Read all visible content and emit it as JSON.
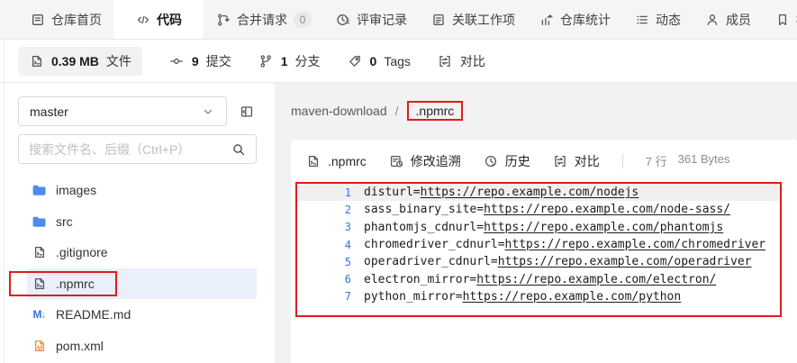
{
  "nav": {
    "items": [
      {
        "name": "repo-home",
        "icon": "repo-icon",
        "label": "仓库首页",
        "active": false
      },
      {
        "name": "code",
        "icon": "code-icon",
        "label": "代码",
        "active": true
      },
      {
        "name": "merge-requests",
        "icon": "merge-icon",
        "label": "合并请求",
        "badge": "0",
        "active": false
      },
      {
        "name": "review-records",
        "icon": "review-clock-icon",
        "label": "评审记录",
        "active": false
      },
      {
        "name": "work-items",
        "icon": "workitem-icon",
        "label": "关联工作项",
        "active": false
      },
      {
        "name": "repo-stats",
        "icon": "chart-icon",
        "label": "仓库统计",
        "active": false
      },
      {
        "name": "activity",
        "icon": "activity-list-icon",
        "label": "动态",
        "active": false
      },
      {
        "name": "members",
        "icon": "member-icon",
        "label": "成员",
        "active": false
      },
      {
        "name": "tags-nav",
        "icon": "bookmark-icon",
        "label": "标",
        "active": false
      }
    ]
  },
  "toolbar": {
    "items": [
      {
        "name": "file-size",
        "icon": "file-code-icon",
        "strong": "0.39 MB",
        "label": "文件",
        "active": true
      },
      {
        "name": "commits",
        "icon": "commit-icon",
        "strong": "9",
        "label": "提交",
        "active": false
      },
      {
        "name": "branches",
        "icon": "branch-icon",
        "strong": "1",
        "label": "分支",
        "active": false
      },
      {
        "name": "tags",
        "icon": "tag-icon",
        "strong": "0",
        "label": "Tags",
        "active": false
      },
      {
        "name": "compare",
        "icon": "compare-icon",
        "strong": "",
        "label": "对比",
        "active": false
      }
    ]
  },
  "sidebar": {
    "branch": "master",
    "search_placeholder": "搜索文件名、后缀（Ctrl+P）",
    "files": [
      {
        "label": "images",
        "icon": "folder-icon",
        "selected": false,
        "annotated": false
      },
      {
        "label": "src",
        "icon": "folder-icon",
        "selected": false,
        "annotated": false
      },
      {
        "label": ".gitignore",
        "icon": "file-code-icon",
        "selected": false,
        "annotated": false
      },
      {
        "label": ".npmrc",
        "icon": "file-code-icon",
        "selected": true,
        "annotated": true
      },
      {
        "label": "README.md",
        "icon": "markdown-icon",
        "selected": false,
        "annotated": false
      },
      {
        "label": "pom.xml",
        "icon": "maven-icon",
        "selected": false,
        "annotated": false
      }
    ]
  },
  "breadcrumb": {
    "repo": "maven-download",
    "separator": "/",
    "file": ".npmrc"
  },
  "viewer": {
    "file_tab": ".npmrc",
    "actions": [
      {
        "name": "blame",
        "icon": "blame-icon",
        "label": "修改追溯"
      },
      {
        "name": "history",
        "icon": "history-icon",
        "label": "历史"
      },
      {
        "name": "compare-file",
        "icon": "compare-icon",
        "label": "对比"
      }
    ],
    "meta": {
      "lines": "7 行",
      "size": "361 Bytes"
    }
  },
  "code": {
    "highlight_line": 1,
    "lines": [
      {
        "num": "1",
        "prefix": "disturl=",
        "url": "https://repo.example.com/nodejs"
      },
      {
        "num": "2",
        "prefix": "sass_binary_site=",
        "url": "https://repo.example.com/node-sass/"
      },
      {
        "num": "3",
        "prefix": "phantomjs_cdnurl=",
        "url": "https://repo.example.com/phantomjs"
      },
      {
        "num": "4",
        "prefix": "chromedriver_cdnurl=",
        "url": "https://repo.example.com/chromedriver"
      },
      {
        "num": "5",
        "prefix": "operadriver_cdnurl=",
        "url": "https://repo.example.com/operadriver"
      },
      {
        "num": "6",
        "prefix": "electron_mirror=",
        "url": "https://repo.example.com/electron/"
      },
      {
        "num": "7",
        "prefix": "python_mirror=",
        "url": "https://repo.example.com/python"
      }
    ]
  },
  "colors": {
    "annotation_red": "#e11b1b",
    "line_number_blue": "#3178dd",
    "folder_blue": "#4f8bee",
    "selected_row_blue": "#e9effb",
    "line_highlight_gray": "#f0f0f0"
  }
}
